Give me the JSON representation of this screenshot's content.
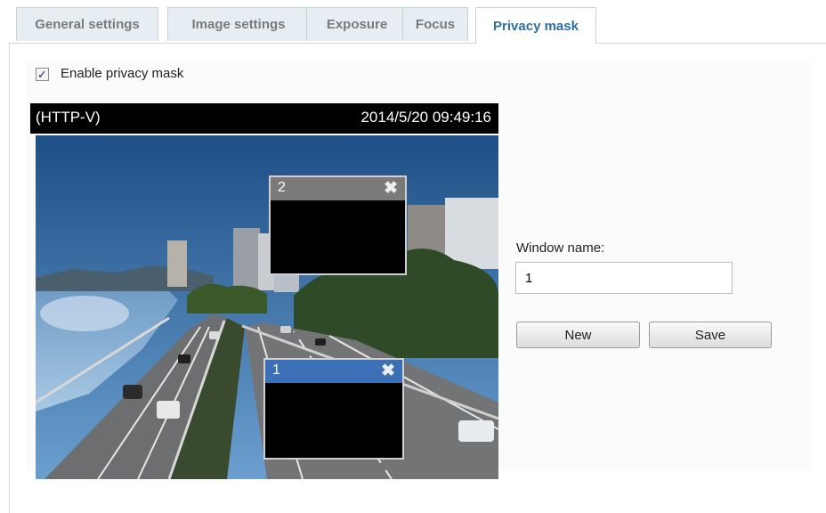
{
  "tabs": [
    {
      "label": "General settings"
    },
    {
      "label": "Image settings"
    },
    {
      "label": "Exposure"
    },
    {
      "label": "Focus"
    },
    {
      "label": "Privacy mask",
      "active": true
    }
  ],
  "enable_mask": {
    "label": "Enable privacy mask",
    "checked": true
  },
  "viewer": {
    "stream": "(HTTP-V)",
    "timestamp": "2014/5/20 09:49:16"
  },
  "masks": [
    {
      "number": "2",
      "close_icon": "close-icon",
      "selected": false
    },
    {
      "number": "1",
      "close_icon": "close-icon",
      "selected": true
    }
  ],
  "form": {
    "window_name_label": "Window name:",
    "window_name_value": "1",
    "new_label": "New",
    "save_label": "Save"
  },
  "colors": {
    "active_tab_text": "#2f6fa3",
    "selected_mask_bar": "#3b6fb6",
    "mask_bar": "#7a7a7a"
  }
}
